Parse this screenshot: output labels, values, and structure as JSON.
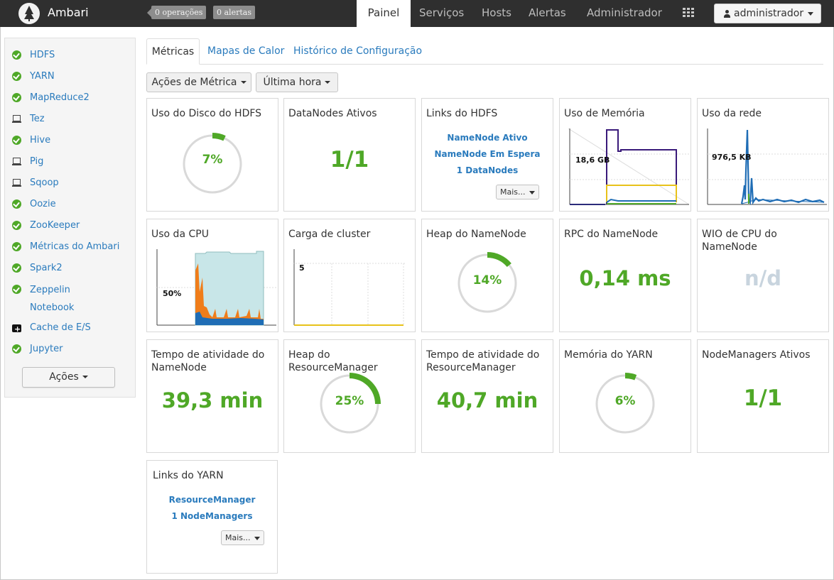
{
  "topbar": {
    "brand": "Ambari",
    "ops_badge": "0 operações",
    "alerts_badge": "0 alertas",
    "nav": [
      "Painel",
      "Serviços",
      "Hosts",
      "Alertas",
      "Administrador"
    ],
    "user": "administrador"
  },
  "sidebar": {
    "services": [
      {
        "label": "HDFS",
        "status": "ok"
      },
      {
        "label": "YARN",
        "status": "ok"
      },
      {
        "label": "MapReduce2",
        "status": "ok"
      },
      {
        "label": "Tez",
        "status": "client"
      },
      {
        "label": "Hive",
        "status": "ok"
      },
      {
        "label": "Pig",
        "status": "client"
      },
      {
        "label": "Sqoop",
        "status": "client"
      },
      {
        "label": "Oozie",
        "status": "ok"
      },
      {
        "label": "ZooKeeper",
        "status": "ok"
      },
      {
        "label": "Métricas do Ambari",
        "status": "ok"
      },
      {
        "label": "Spark2",
        "status": "ok"
      },
      {
        "label": "Zeppelin Notebook",
        "status": "ok"
      },
      {
        "label": "Cache de E/S",
        "status": "kit"
      },
      {
        "label": "Jupyter",
        "status": "ok"
      }
    ],
    "actions_label": "Ações"
  },
  "tabs": [
    "Métricas",
    "Mapas de Calor",
    "Histórico de Configuração"
  ],
  "toolbar": {
    "metric_actions": "Ações de Métrica",
    "time_range": "Última hora"
  },
  "widgets": {
    "hdfs_disk": {
      "title": "Uso do Disco do HDFS",
      "label": "7%",
      "fraction": 0.07
    },
    "datanodes": {
      "title": "DataNodes Ativos",
      "value": "1/1"
    },
    "hdfs_links": {
      "title": "Links do HDFS",
      "links": [
        "NameNode Ativo",
        "NameNode Em Espera",
        "1 DataNodes"
      ],
      "more": "Mais..."
    },
    "memory": {
      "title": "Uso de Memória",
      "label": "18,6 GB"
    },
    "network": {
      "title": "Uso da rede",
      "label": "976,5 KB"
    },
    "cpu": {
      "title": "Uso da CPU",
      "label": "50%"
    },
    "cluster_load": {
      "title": "Carga de cluster",
      "label": "5"
    },
    "nn_heap": {
      "title": "Heap do NameNode",
      "label": "14%",
      "fraction": 0.14
    },
    "nn_rpc": {
      "title": "RPC do NameNode",
      "value": "0,14 ms"
    },
    "nn_cpu_wio": {
      "title": "WIO de CPU do NameNode",
      "value": "n/d"
    },
    "nn_uptime": {
      "title": "Tempo de atividade do NameNode",
      "value": "39,3 min"
    },
    "rm_heap": {
      "title": "Heap do ResourceManager",
      "label": "25%",
      "fraction": 0.25
    },
    "rm_uptime": {
      "title": "Tempo de atividade do ResourceManager",
      "value": "40,7 min"
    },
    "yarn_memory": {
      "title": "Memória do YARN",
      "label": "6%",
      "fraction": 0.06
    },
    "nodemanagers": {
      "title": "NodeManagers Ativos",
      "value": "1/1"
    },
    "yarn_links": {
      "title": "Links do YARN",
      "links": [
        "ResourceManager",
        "1 NodeManagers"
      ],
      "more": "Mais..."
    }
  },
  "colors": {
    "accent": "#4fa827",
    "link": "#2a7bbd",
    "topbar": "#2f2f2f"
  }
}
